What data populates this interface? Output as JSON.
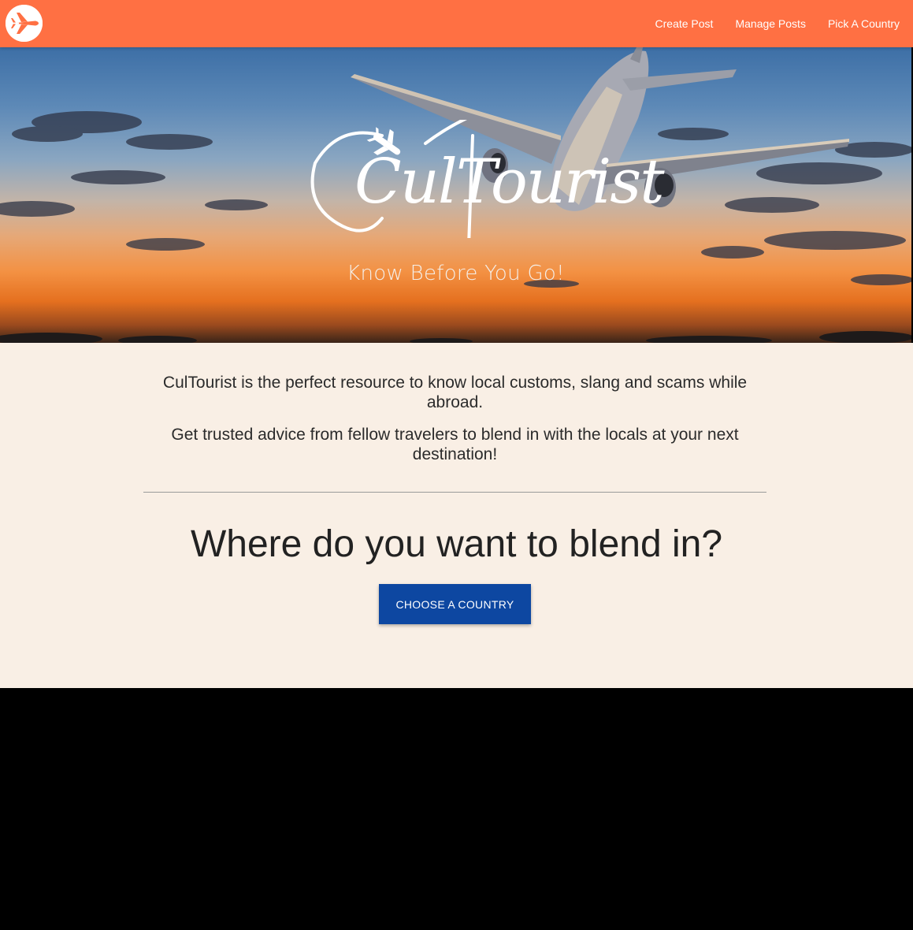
{
  "navbar": {
    "logo_icon": "airplane-circle-icon",
    "links": [
      {
        "label": "Create Post"
      },
      {
        "label": "Manage Posts"
      },
      {
        "label": "Pick A Country"
      }
    ],
    "background_color": "#ff7043"
  },
  "hero": {
    "brand": "CulTourist",
    "tagline": "Know Before You Go!"
  },
  "content": {
    "intro_line_1": "CulTourist is the perfect resource to know local customs, slang and scams while abroad.",
    "intro_line_2": "Get trusted advice from fellow travelers to blend in with the locals at your next destination!",
    "heading": "Where do you want to blend in?",
    "cta_label": "Choose a Country",
    "cta_color": "#0d47a1",
    "background_color": "#f9efe5"
  }
}
